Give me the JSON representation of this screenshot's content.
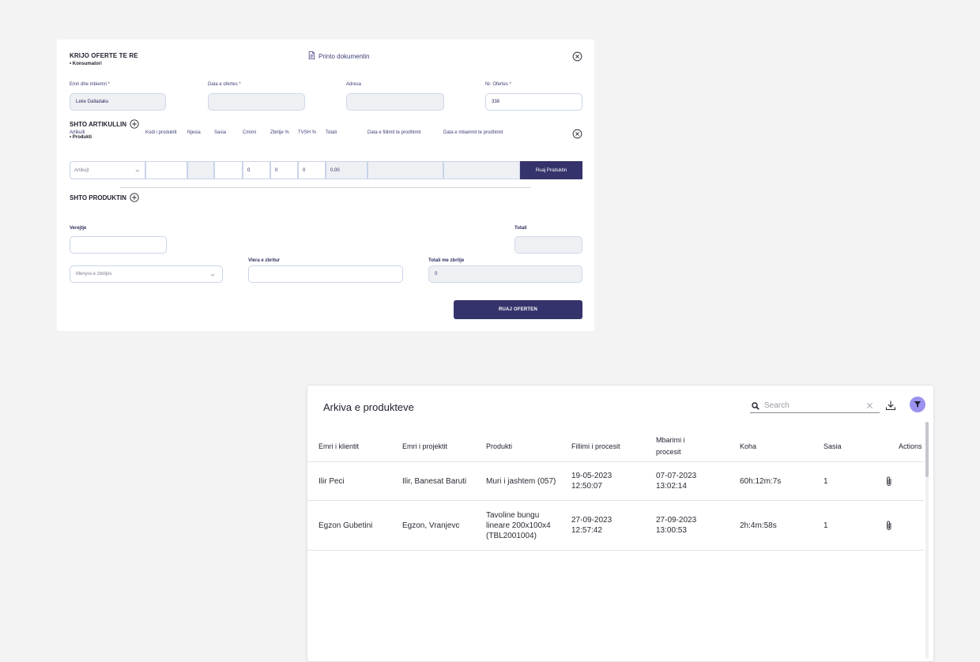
{
  "form": {
    "title": "KRIJO OFERTE TE RE",
    "subtitle": "• Konsumatori",
    "print_label": "Printo dokumentin",
    "fields": {
      "name_label": "Emri dhe mbiemri *",
      "name_value": "Leke Dalladaku",
      "date_label": "Data e ofertes *",
      "date_value": "",
      "address_label": "Adresa",
      "address_value": "",
      "offer_no_label": "Nr. Ofertes *",
      "offer_no_value": "338"
    },
    "add_article_label": "SHTO ARTIKULLIN",
    "product_sub": "• Produkti",
    "product_columns": {
      "article": "Artikulli",
      "code": "Kodi i produktit",
      "unit": "Njesia",
      "qty": "Sasia",
      "price": "Cmimi",
      "discount": "Zbritje %",
      "vat": "TVSH %",
      "total": "Totali",
      "start_date": "Data e fillimit te prodhimit",
      "end_date": "Data e mbarimit te prodhimit"
    },
    "product_row": {
      "article_select": "Artikujt",
      "code": "",
      "unit": "",
      "qty": "",
      "price": "0",
      "discount": "0",
      "vat": "0",
      "total": "0.00",
      "start_date": "",
      "end_date": ""
    },
    "save_product_label": "Ruaj Produktin",
    "add_product_label": "SHTO PRODUKTIN",
    "notes_label": "Verejtje",
    "notes_value": "",
    "total_label": "Totali",
    "total_value": "",
    "discount_method_placeholder": "Menyra e zbritjes",
    "discount_value_label": "Vlera e zbritur",
    "discount_value": "",
    "total_with_discount_label": "Totali me zbritje",
    "total_with_discount_value": "0",
    "save_offer_label": "RUAJ OFERTEN"
  },
  "archive": {
    "title": "Arkiva e produkteve",
    "search_placeholder": "Search",
    "columns": {
      "client": "Emri i klientit",
      "project": "Emri i projektit",
      "product": "Produkti",
      "start": "Fillimi i procesit",
      "end": "Mbarimi i procesit",
      "time": "Koha",
      "qty": "Sasia",
      "actions": "Actions"
    },
    "rows": [
      {
        "client": "Ilir Peci",
        "project": "Ilir, Banesat Baruti",
        "product": "Muri i jashtem (057)",
        "start": "19-05-2023 12:50:07",
        "end": "07-07-2023 13:02:14",
        "time": "60h:12m:7s",
        "qty": "1"
      },
      {
        "client": "Egzon Gubetini",
        "project": "Egzon, Vranjevc",
        "product": "Tavoline bungu lineare 200x100x4 (TBL2001004)",
        "start": "27-09-2023 12:57:42",
        "end": "27-09-2023 13:00:53",
        "time": "2h:4m:58s",
        "qty": "1"
      }
    ],
    "icons": {
      "search": "search-icon",
      "clear": "close-icon",
      "download": "download-icon",
      "filter": "filter-icon",
      "attachment": "paperclip-icon"
    },
    "colors": {
      "accent": "#35336b",
      "filter_bg": "#9b91ee"
    }
  }
}
